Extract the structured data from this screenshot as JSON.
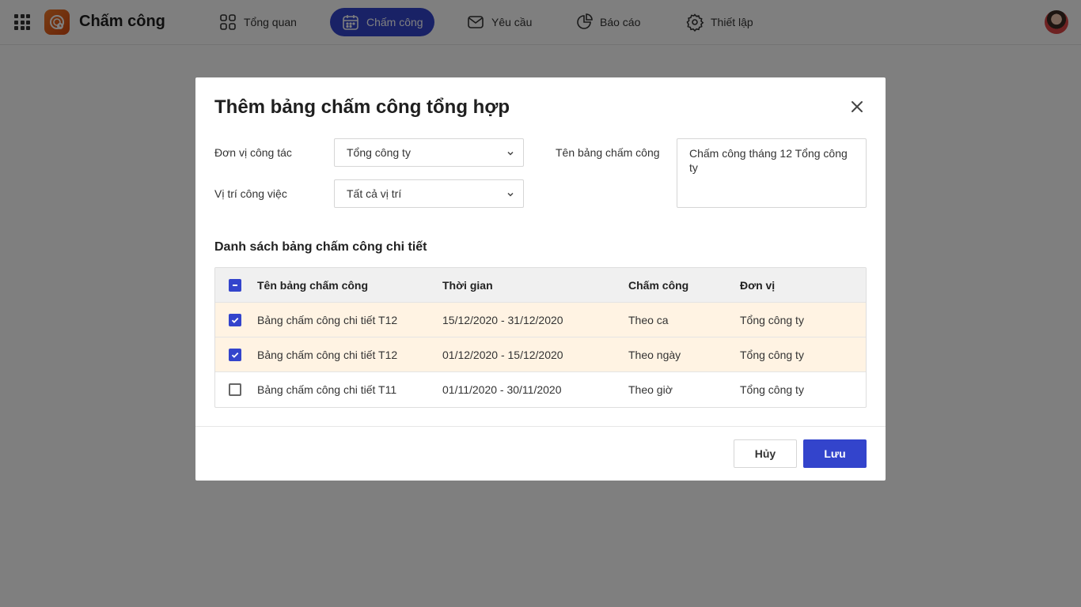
{
  "app": {
    "title": "Chấm công"
  },
  "nav": [
    {
      "label": "Tổng quan",
      "icon": "grid-icon"
    },
    {
      "label": "Chấm công",
      "icon": "calendar-icon",
      "active": true
    },
    {
      "label": "Yêu cầu",
      "icon": "mail-icon"
    },
    {
      "label": "Báo cáo",
      "icon": "pie-chart-icon"
    },
    {
      "label": "Thiết lập",
      "icon": "gear-icon"
    }
  ],
  "modal": {
    "title": "Thêm bảng chấm công tổng hợp",
    "fields": {
      "unit_label": "Đơn vị công tác",
      "unit_value": "Tổng công ty",
      "position_label": "Vị trí công việc",
      "position_value": "Tất cả vị trí",
      "name_label": "Tên bảng chấm công",
      "name_value": "Chấm công tháng 12 Tổng công ty"
    },
    "section_title": "Danh sách bảng chấm công chi tiết",
    "table": {
      "headers": [
        "Tên bảng chấm công",
        "Thời gian",
        "Chấm công",
        "Đơn vị"
      ],
      "rows": [
        {
          "checked": true,
          "name": "Bảng chấm công chi tiết T12",
          "time": "15/12/2020 - 31/12/2020",
          "type": "Theo ca",
          "unit": "Tổng công ty"
        },
        {
          "checked": true,
          "name": "Bảng chấm công chi tiết T12",
          "time": "01/12/2020 - 15/12/2020",
          "type": "Theo ngày",
          "unit": "Tổng công ty"
        },
        {
          "checked": false,
          "name": "Bảng chấm công chi tiết T11",
          "time": "01/11/2020 - 30/11/2020",
          "type": "Theo giờ",
          "unit": "Tổng công ty"
        }
      ]
    },
    "buttons": {
      "cancel": "Hủy",
      "save": "Lưu"
    }
  },
  "colors": {
    "accent": "#3344cc",
    "selected_row": "#fff3e3",
    "overlay": "rgba(0,0,0,0.5)"
  }
}
